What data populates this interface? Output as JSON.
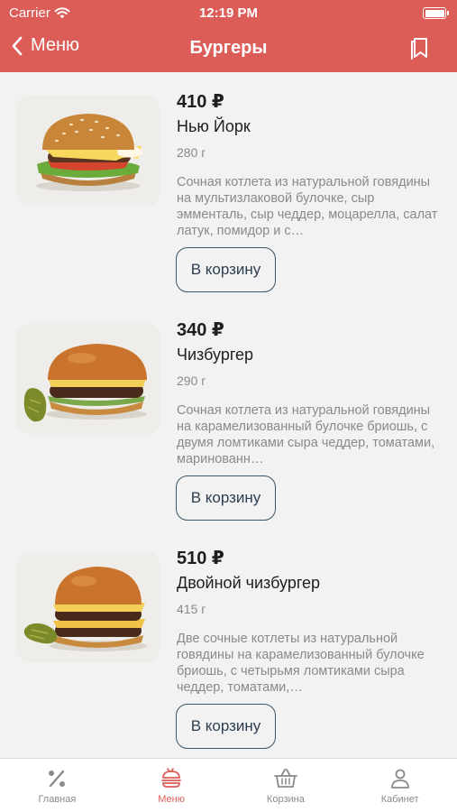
{
  "status_bar": {
    "carrier": "Carrier",
    "time": "12:19 PM",
    "battery_level": 1.0
  },
  "nav": {
    "back_label": "Меню",
    "title": "Бургеры",
    "bookmark_icon": "bookmark-icon"
  },
  "products": [
    {
      "price": "410 ₽",
      "name": "Нью Йорк",
      "weight": "280 г",
      "description": "Сочная котлета из натуральной говядины на мультизлаковой булочке, сыр эмменталь, сыр чеддер, моцарелла, салат латук, помидор и с…",
      "button": "В корзину"
    },
    {
      "price": "340 ₽",
      "name": "Чизбургер",
      "weight": "290 г",
      "description": "Сочная котлета из натуральной говядины на карамелизованный булочке бриошь, с двумя ломтиками сыра чеддер, томатами, маринованн…",
      "button": "В корзину"
    },
    {
      "price": "510 ₽",
      "name": "Двойной чизбургер",
      "weight": "415 г",
      "description": "Две сочные котлеты из натуральной говядины на карамелизованный булочке бриошь, с четырьмя ломтиками сыра чеддер, томатами,…",
      "button": "В корзину"
    }
  ],
  "tabbar": {
    "active_index": 1,
    "accent_color": "#dc5c57",
    "items": [
      {
        "label": "Главная",
        "icon": "percent-icon"
      },
      {
        "label": "Меню",
        "icon": "burger-menu-icon"
      },
      {
        "label": "Корзина",
        "icon": "basket-icon"
      },
      {
        "label": "Кабинет",
        "icon": "user-icon"
      }
    ]
  }
}
